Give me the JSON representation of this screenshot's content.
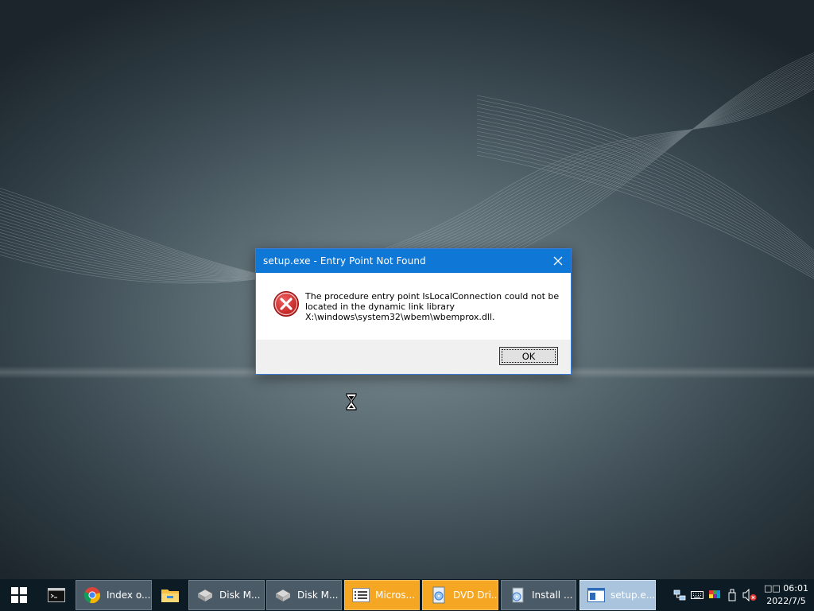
{
  "dialog": {
    "title": "setup.exe - Entry Point Not Found",
    "message_line1": "The procedure entry point IsLocalConnection could not be",
    "message_line2": "located in the dynamic link library",
    "message_line3": "X:\\windows\\system32\\wbem\\wbemprox.dll.",
    "ok_label": "OK",
    "close_icon": "close-icon",
    "error_icon": "error-x-circle-icon"
  },
  "taskbar": {
    "items": [
      {
        "label": "Index o...",
        "icon": "chrome-icon"
      },
      {
        "label": "",
        "icon": "file-explorer-icon"
      },
      {
        "label": "Disk M...",
        "icon": "disk-management-icon"
      },
      {
        "label": "Disk M...",
        "icon": "disk-management-icon"
      },
      {
        "label": "Micros...",
        "icon": "list-window-icon"
      },
      {
        "label": "DVD Dri...",
        "icon": "dvd-driver-icon"
      },
      {
        "label": "Install ...",
        "icon": "installer-icon"
      },
      {
        "label": "setup.e...",
        "icon": "window-icon"
      }
    ],
    "clock_time": "□□ 06:01",
    "clock_date": "2022/7/5"
  },
  "colors": {
    "titlebar": "#0f78d7",
    "taskbar": "#0d1b24",
    "taskbar_orange": "#f5a623",
    "taskbar_active": "#a9c4dc"
  }
}
